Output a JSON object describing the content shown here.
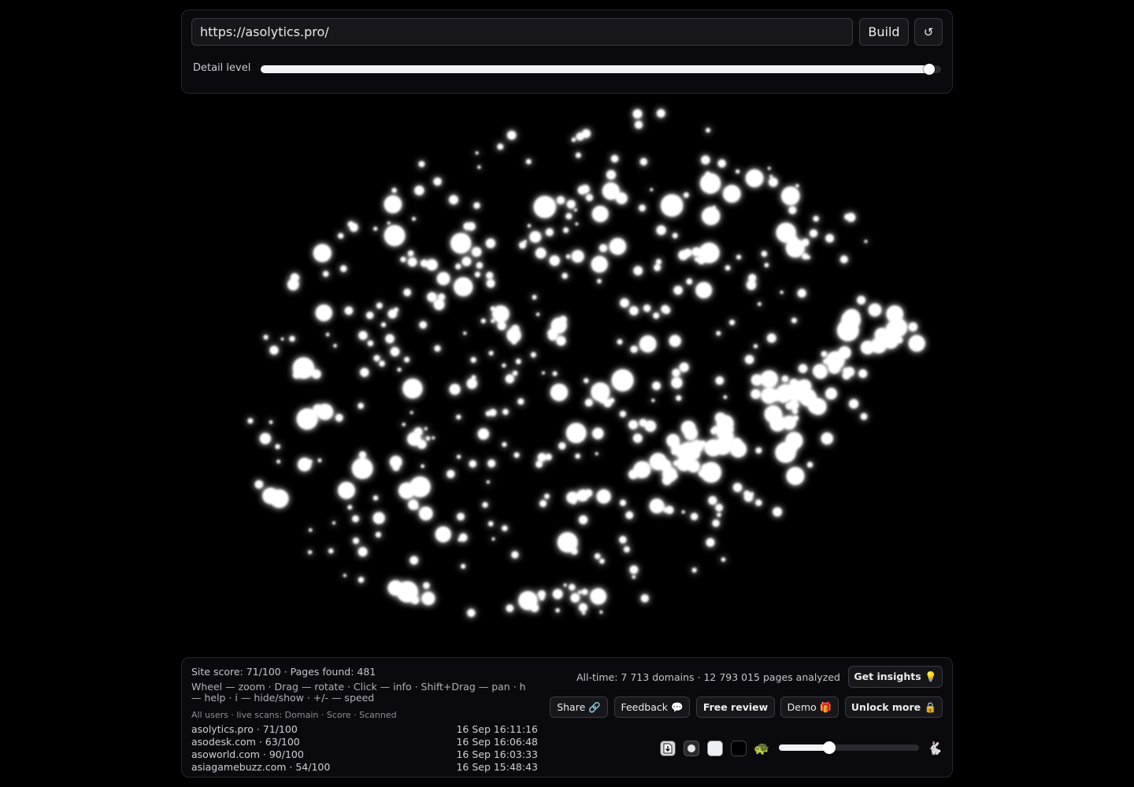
{
  "url_input": {
    "value": "https://asolytics.pro/",
    "placeholder": ""
  },
  "build_label": "Build",
  "reset_label": "↺",
  "detail": {
    "label": "Detail level",
    "level": 0.983
  },
  "stats": {
    "site_score": "Site score: 71/100 · Pages found: 481",
    "help": "Wheel — zoom · Drag — rotate · Click — info · Shift+Drag — pan · h — help · i — hide/show · +/- — speed",
    "live_label": "All users · live scans: Domain · Score · Scanned",
    "alltime": "All-time: 7 713 domains · 12 793 015 pages analyzed"
  },
  "scans": [
    {
      "domain": "asolytics.pro · 71/100",
      "time": "16 Sep 16:11:16"
    },
    {
      "domain": "asodesk.com · 63/100",
      "time": "16 Sep 16:06:48"
    },
    {
      "domain": "asoworld.com · 90/100",
      "time": "16 Sep 16:03:33"
    },
    {
      "domain": "asiagamebuzz.com · 54/100",
      "time": "16 Sep 15:48:43"
    }
  ],
  "buttons": {
    "insights": "Get insights 💡",
    "share": "Share 🔗",
    "feedback": "Feedback 💬",
    "review": "Free review",
    "demo": "Demo 🎁",
    "unlock": "Unlock more 🔒"
  },
  "controls": {
    "download_icon": "download-icon",
    "turtle": "🐢",
    "rabbit": "🐇",
    "speed_level": 0.36
  },
  "colors": {
    "background": "#000000",
    "node": "#ffffff",
    "node_glow": "#9aa0ff"
  }
}
